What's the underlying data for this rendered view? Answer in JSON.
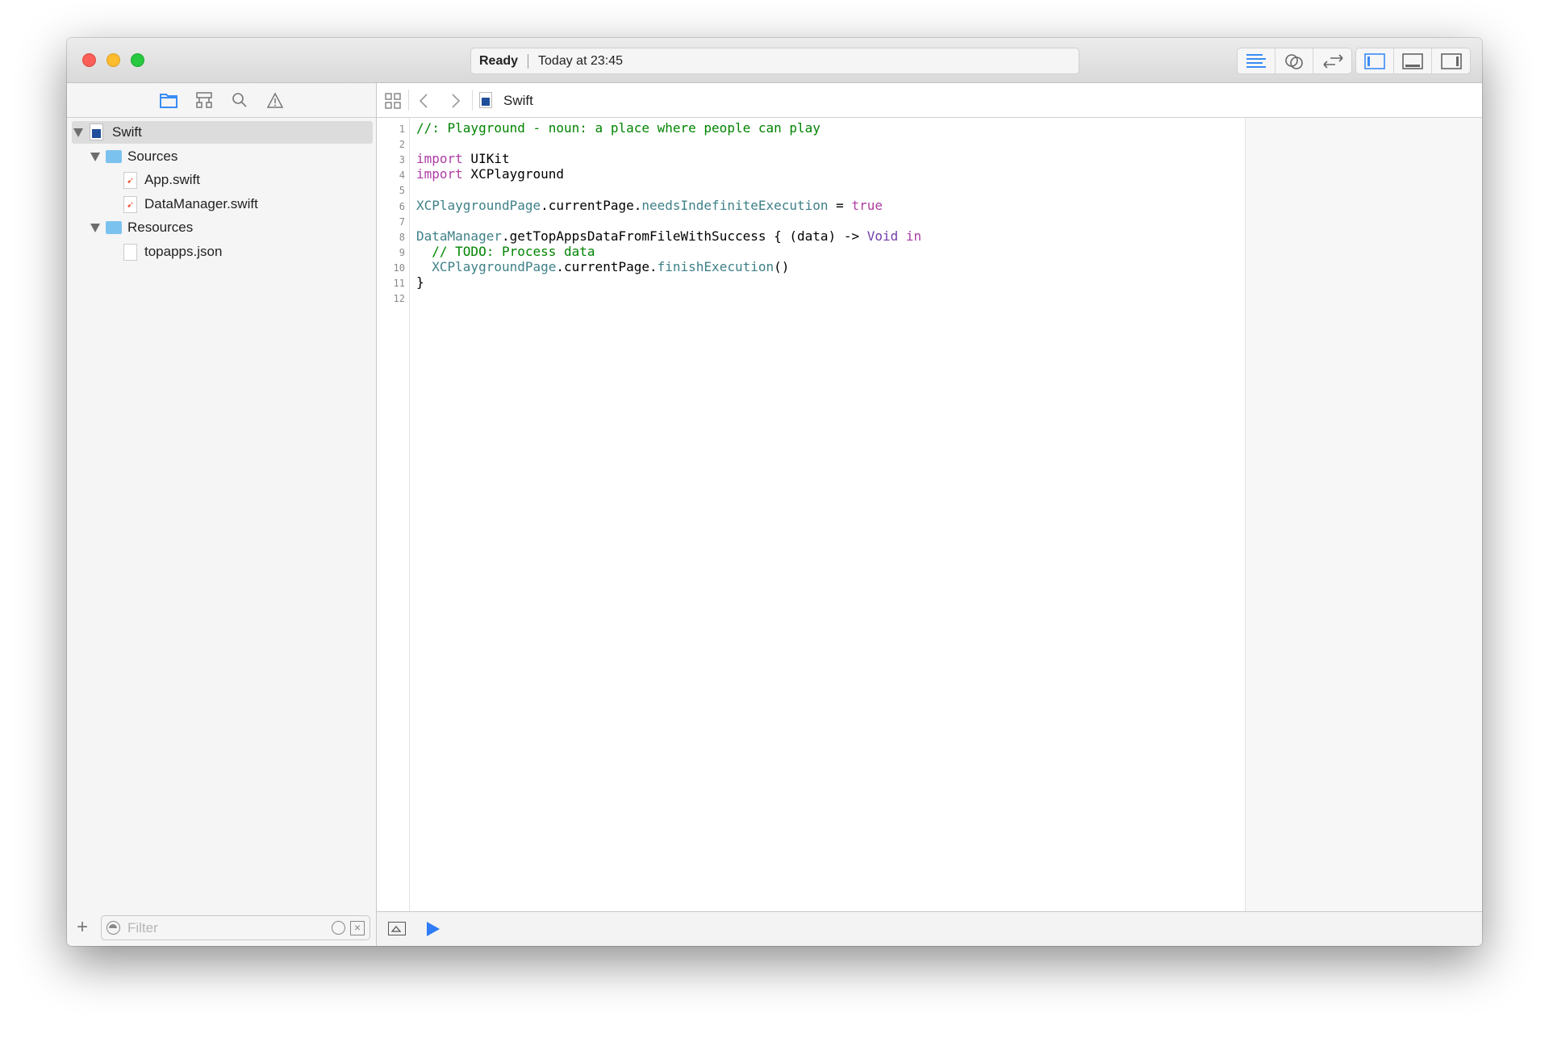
{
  "status": {
    "state": "Ready",
    "time": "Today at 23:45"
  },
  "toolbar": {
    "icons": [
      "standard-editor-icon",
      "assistant-editor-icon",
      "version-editor-icon",
      "navigator-toggle-icon",
      "debug-area-toggle-icon",
      "utilities-toggle-icon"
    ]
  },
  "navigator": {
    "tabs": [
      "project-navigator-icon",
      "symbol-navigator-icon",
      "find-navigator-icon",
      "issue-navigator-icon"
    ],
    "tree": [
      {
        "label": "Swift",
        "type": "playground"
      },
      {
        "label": "Sources",
        "type": "folder"
      },
      {
        "label": "App.swift",
        "type": "swift-file"
      },
      {
        "label": "DataManager.swift",
        "type": "swift-file"
      },
      {
        "label": "Resources",
        "type": "folder"
      },
      {
        "label": "topapps.json",
        "type": "file"
      }
    ],
    "filter_placeholder": "Filter"
  },
  "jumpbar": {
    "title": "Swift"
  },
  "editor": {
    "line_numbers": [
      "1",
      "2",
      "3",
      "4",
      "5",
      "6",
      "7",
      "8",
      "9",
      "10",
      "11",
      "12"
    ],
    "lines": [
      [
        {
          "c": "c",
          "t": "//: Playground - noun: a place where people can play"
        }
      ],
      [],
      [
        {
          "c": "k",
          "t": "import"
        },
        {
          "c": "",
          "t": " UIKit"
        }
      ],
      [
        {
          "c": "k",
          "t": "import"
        },
        {
          "c": "",
          "t": " XCPlayground"
        }
      ],
      [],
      [
        {
          "c": "t",
          "t": "XCPlaygroundPage"
        },
        {
          "c": "",
          "t": ".currentPage."
        },
        {
          "c": "t",
          "t": "needsIndefiniteExecution"
        },
        {
          "c": "",
          "t": " = "
        },
        {
          "c": "k",
          "t": "true"
        }
      ],
      [],
      [
        {
          "c": "t",
          "t": "DataManager"
        },
        {
          "c": "",
          "t": ".getTopAppsDataFromFileWithSuccess { (data) -> "
        },
        {
          "c": "p",
          "t": "Void"
        },
        {
          "c": "",
          "t": " "
        },
        {
          "c": "k",
          "t": "in"
        }
      ],
      [
        {
          "c": "c",
          "t": "  // TODO: Process data"
        }
      ],
      [
        {
          "c": "",
          "t": "  "
        },
        {
          "c": "t",
          "t": "XCPlaygroundPage"
        },
        {
          "c": "",
          "t": ".currentPage."
        },
        {
          "c": "t",
          "t": "finishExecution"
        },
        {
          "c": "",
          "t": "()"
        }
      ],
      [
        {
          "c": "",
          "t": "}"
        }
      ],
      []
    ]
  }
}
